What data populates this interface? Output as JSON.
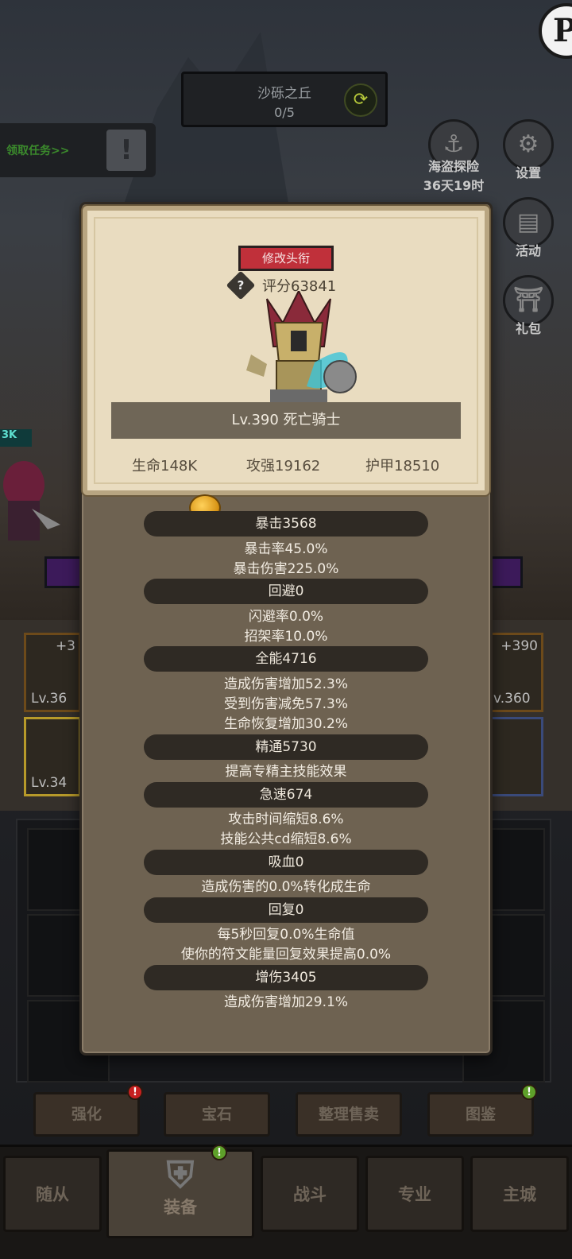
{
  "stage": {
    "name": "沙砾之丘",
    "progress": "0/5"
  },
  "quest": {
    "label": "领取任务>>"
  },
  "side_buttons": {
    "pirate_explore": {
      "label": "海盗探险",
      "timer": "36天19时"
    },
    "settings": {
      "label": "设置"
    },
    "activity": {
      "label": "活动"
    },
    "gift": {
      "label": "礼包"
    }
  },
  "left_hero": {
    "hp_tag": "3K"
  },
  "equipment_slots": [
    {
      "plus": "+3",
      "level": "Lv.36"
    },
    {
      "plus": "",
      "level": "Lv.34"
    },
    {
      "plus": "+390",
      "level": "v.360"
    },
    {
      "plus": "",
      "level": ""
    }
  ],
  "action_buttons": [
    {
      "label": "强化",
      "badge": "!"
    },
    {
      "label": "宝石",
      "badge": ""
    },
    {
      "label": "整理售卖",
      "badge": ""
    },
    {
      "label": "图鉴",
      "badge": "!"
    }
  ],
  "nav_tabs": [
    {
      "label": "随从"
    },
    {
      "label": "装备",
      "badge": "!"
    },
    {
      "label": "战斗"
    },
    {
      "label": "专业"
    },
    {
      "label": "主城"
    }
  ],
  "profile": {
    "title_button": "修改头衔",
    "help": "?",
    "score": "评分63841",
    "name": "Lv.390 死亡骑士",
    "hp": "生命148K",
    "attack": "攻强19162",
    "armor": "护甲18510"
  },
  "sections": [
    {
      "header": "暴击3568",
      "lines": [
        "暴击率45.0%",
        "暴击伤害225.0%"
      ]
    },
    {
      "header": "回避0",
      "lines": [
        "闪避率0.0%",
        "招架率10.0%"
      ]
    },
    {
      "header": "全能4716",
      "lines": [
        "造成伤害增加52.3%",
        "受到伤害减免57.3%",
        "生命恢复增加30.2%"
      ]
    },
    {
      "header": "精通5730",
      "lines": [
        "提高专精主技能效果"
      ]
    },
    {
      "header": "急速674",
      "lines": [
        "攻击时间缩短8.6%",
        "技能公共cd缩短8.6%"
      ]
    },
    {
      "header": "吸血0",
      "lines": [
        "造成伤害的0.0%转化成生命"
      ]
    },
    {
      "header": "回复0",
      "lines": [
        "每5秒回复0.0%生命值",
        "使你的符文能量回复效果提高0.0%"
      ]
    },
    {
      "header": "增伤3405",
      "lines": [
        "造成伤害增加29.1%"
      ]
    }
  ]
}
